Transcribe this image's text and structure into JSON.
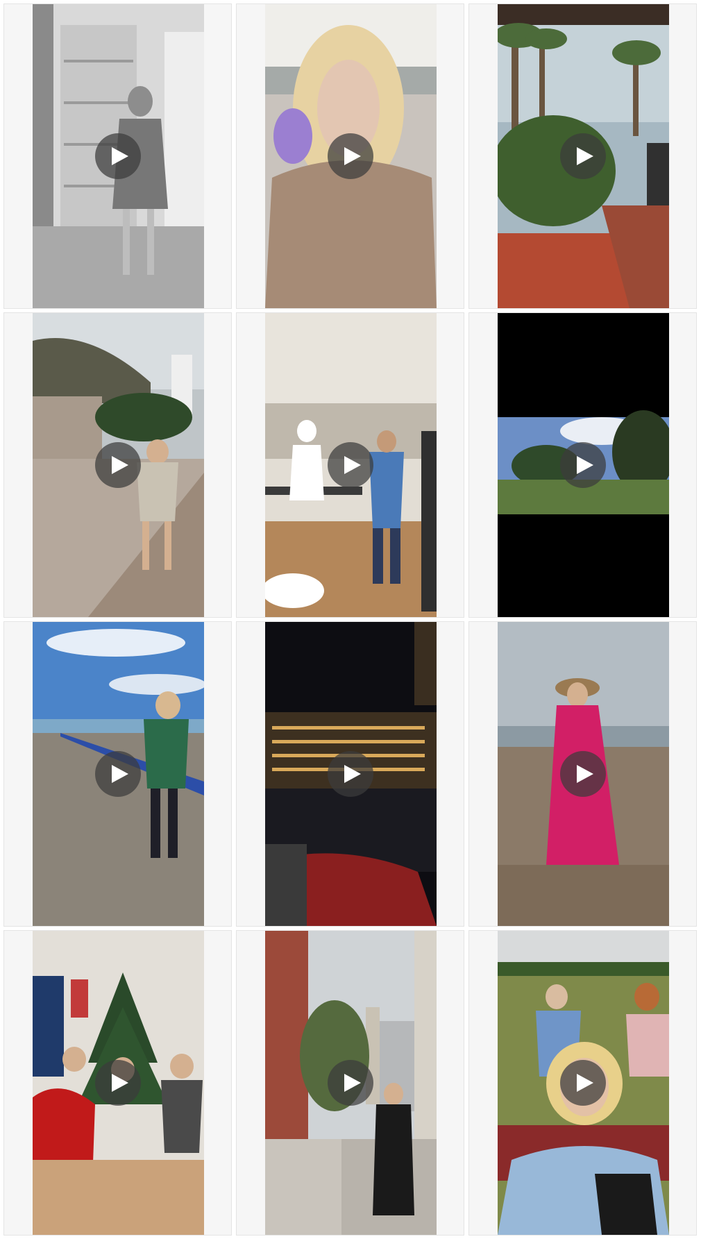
{
  "grid": {
    "columns": 3,
    "rows": 4
  },
  "videos": [
    {
      "id": "reel-1",
      "scene": "mirror-selfie",
      "play_icon": "play-icon"
    },
    {
      "id": "reel-2",
      "scene": "windy-seaside-selfie",
      "play_icon": "play-icon"
    },
    {
      "id": "reel-3",
      "scene": "palm-garden-rain",
      "play_icon": "play-icon"
    },
    {
      "id": "reel-4",
      "scene": "town-square",
      "play_icon": "play-icon"
    },
    {
      "id": "reel-5",
      "scene": "kitchen-party",
      "play_icon": "play-icon"
    },
    {
      "id": "reel-6",
      "scene": "grass-sky-letterbox",
      "play_icon": "play-icon"
    },
    {
      "id": "reel-7",
      "scene": "seaside-promenade",
      "play_icon": "play-icon"
    },
    {
      "id": "reel-8",
      "scene": "night-river",
      "play_icon": "play-icon"
    },
    {
      "id": "reel-9",
      "scene": "pebble-beach",
      "play_icon": "play-icon"
    },
    {
      "id": "reel-10",
      "scene": "christmas-family",
      "play_icon": "play-icon"
    },
    {
      "id": "reel-11",
      "scene": "city-street",
      "play_icon": "play-icon"
    },
    {
      "id": "reel-12",
      "scene": "picnic-selfie",
      "play_icon": "play-icon"
    }
  ],
  "colors": {
    "cell_background": "#f6f6f6",
    "play_overlay": "rgba(60,60,60,0.72)",
    "play_glyph": "#ffffff"
  }
}
